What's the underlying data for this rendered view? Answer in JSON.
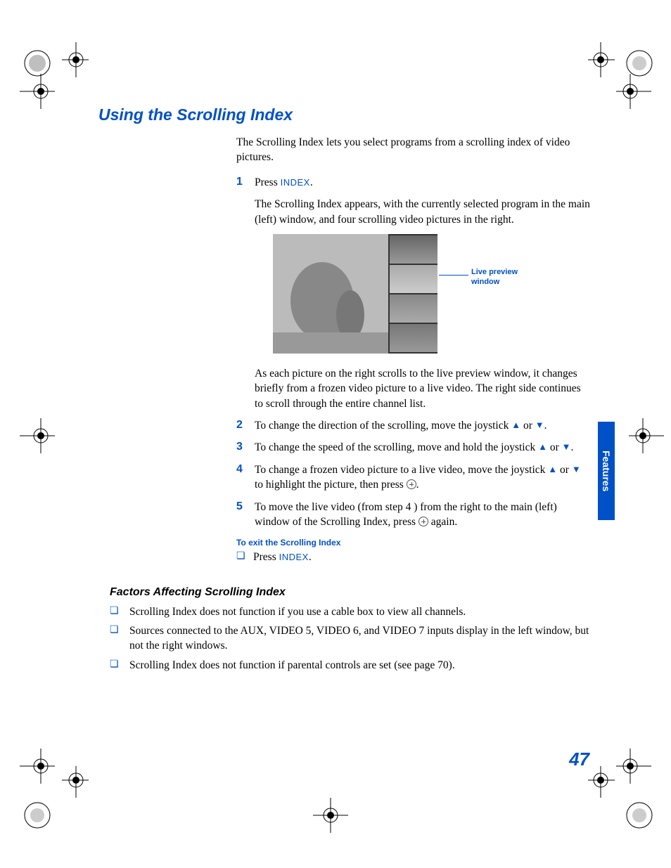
{
  "heading": "Using the Scrolling Index",
  "intro": "The Scrolling Index lets you select programs from a scrolling index of video pictures.",
  "keywords": {
    "index": "INDEX"
  },
  "steps": {
    "s1": {
      "a": "Press ",
      "b": ".",
      "c": "The Scrolling Index appears, with the currently selected program in the main (left) window, and four scrolling video pictures in the right.",
      "d": "As each picture on the right scrolls to the live preview window, it changes briefly from a frozen video picture to a live video. The right side continues to scroll through the entire channel list."
    },
    "s2": "To change the direction of the scrolling, move the joystick ",
    "s2_mid": " or ",
    "s2_end": ".",
    "s3": "To change the speed of the scrolling, move and hold the joystick ",
    "s3_mid": " or ",
    "s3_end": ".",
    "s4a": "To change a frozen video picture to a live video, move the joystick ",
    "s4_mid": " or ",
    "s4b": " to highlight the picture, then press ",
    "s4_end": ".",
    "s5a": "To move the live video (from step 4 ) from the right to the main (left) window of the Scrolling Index, press ",
    "s5b": " again."
  },
  "callout": {
    "l1": "Live preview",
    "l2": "window"
  },
  "exit_head": "To exit the Scrolling Index",
  "exit_body_a": "Press ",
  "exit_body_b": ".",
  "factors_head": "Factors Affecting Scrolling Index",
  "factors": {
    "f1": "Scrolling Index does not function if you use a cable box to view all channels.",
    "f2": "Sources connected to the AUX, VIDEO 5, VIDEO 6, and VIDEO 7 inputs display in the left window, but not the right windows.",
    "f3": "Scrolling Index does not function if parental controls are set (see page 70)."
  },
  "side_tab": "Features",
  "page_number": "47"
}
